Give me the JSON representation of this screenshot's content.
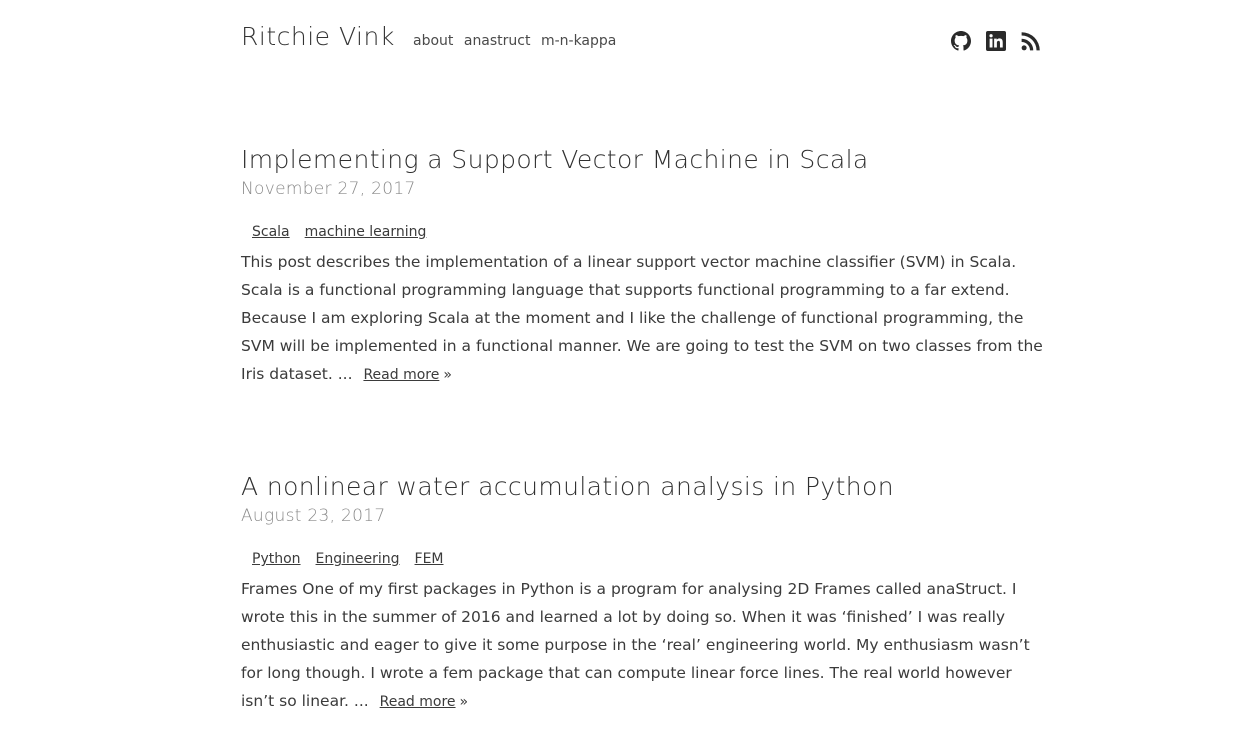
{
  "header": {
    "site_title": "Ritchie Vink",
    "nav": [
      "about",
      "anastruct",
      "m-n-kappa"
    ],
    "social_icons": [
      "github-icon",
      "linkedin-icon",
      "rss-icon"
    ]
  },
  "posts": [
    {
      "title": "Implementing a Support Vector Machine in Scala",
      "date": "November 27, 2017",
      "tags": [
        "Scala",
        "machine learning"
      ],
      "excerpt": "This post describes the implementation of a linear support vector machine classifier (SVM) in Scala. Scala is a functional programming language that supports functional programming to a far extend. Because I am exploring Scala at the moment and I like the challenge of functional programming, the SVM will be implemented in a functional manner. We are going to test the SVM on two classes from the Iris dataset. ...",
      "read_more": "Read more",
      "arrow": "»"
    },
    {
      "title": "A nonlinear water accumulation analysis in Python",
      "date": "August 23, 2017",
      "tags": [
        "Python",
        "Engineering",
        "FEM"
      ],
      "excerpt": "Frames One of my first packages in Python is a program for analysing 2D Frames called anaStruct. I wrote this in the summer of 2016 and learned a lot by doing so. When it was ‘finished’ I was really enthusiastic and eager to give it some purpose in the ‘real’ engineering world. My enthusiasm wasn’t for long though. I wrote a fem package that can compute linear force lines. The real world however isn’t so linear. ...",
      "read_more": "Read more",
      "arrow": "»"
    }
  ]
}
